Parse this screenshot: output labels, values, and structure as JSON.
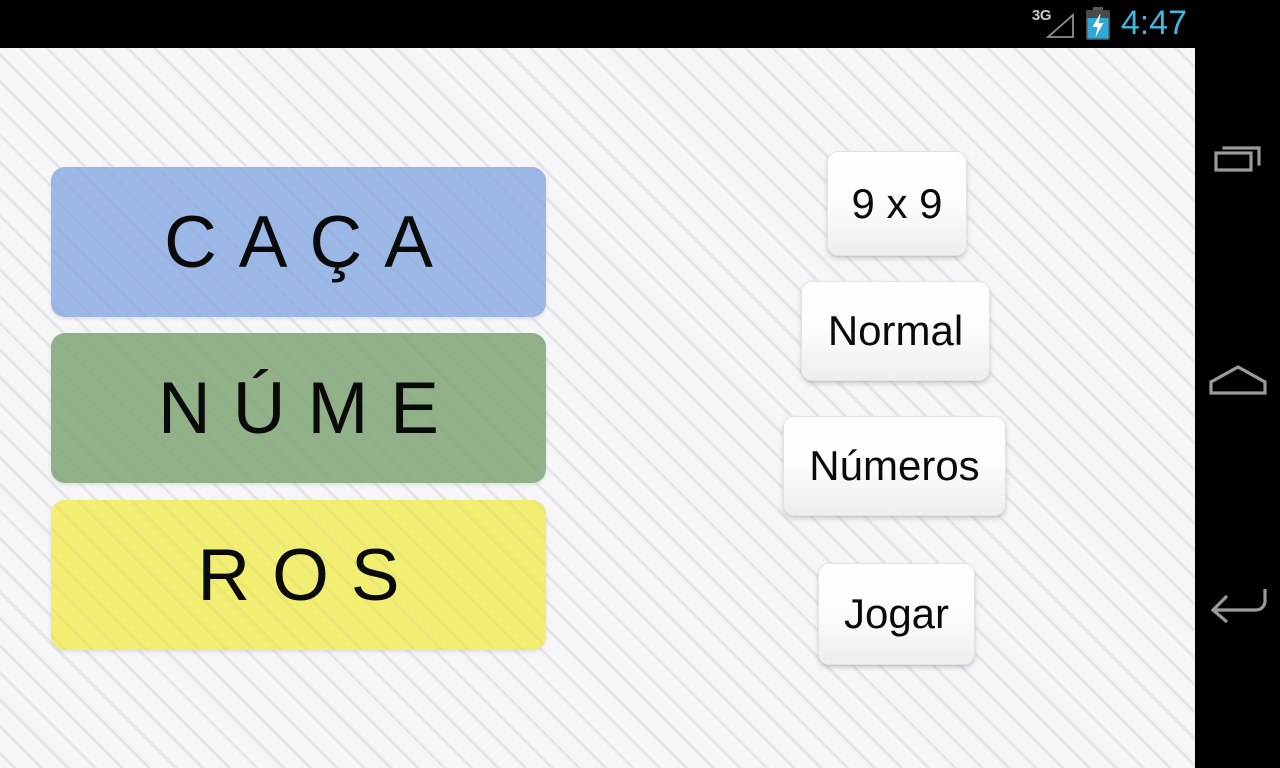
{
  "status_bar": {
    "network_label": "3G",
    "signal_icon": "signal-triangle-empty-icon",
    "battery_icon": "battery-charging-icon",
    "clock": "4:47",
    "clock_color": "#3fb8e0"
  },
  "title_tiles": [
    {
      "text": "CAÇA",
      "color": "#9cb8e6",
      "name": "tile-caca"
    },
    {
      "text": "NÚME",
      "color": "#91b288",
      "name": "tile-nume"
    },
    {
      "text": "ROS",
      "color": "#f2ee72",
      "name": "tile-ros"
    }
  ],
  "options": {
    "board_size": "9 x 9",
    "difficulty": "Normal",
    "mode": "Números",
    "play": "Jogar"
  },
  "nav_bar": {
    "recents_icon": "recents-icon",
    "home_icon": "home-icon",
    "back_icon": "back-arrow-icon"
  }
}
